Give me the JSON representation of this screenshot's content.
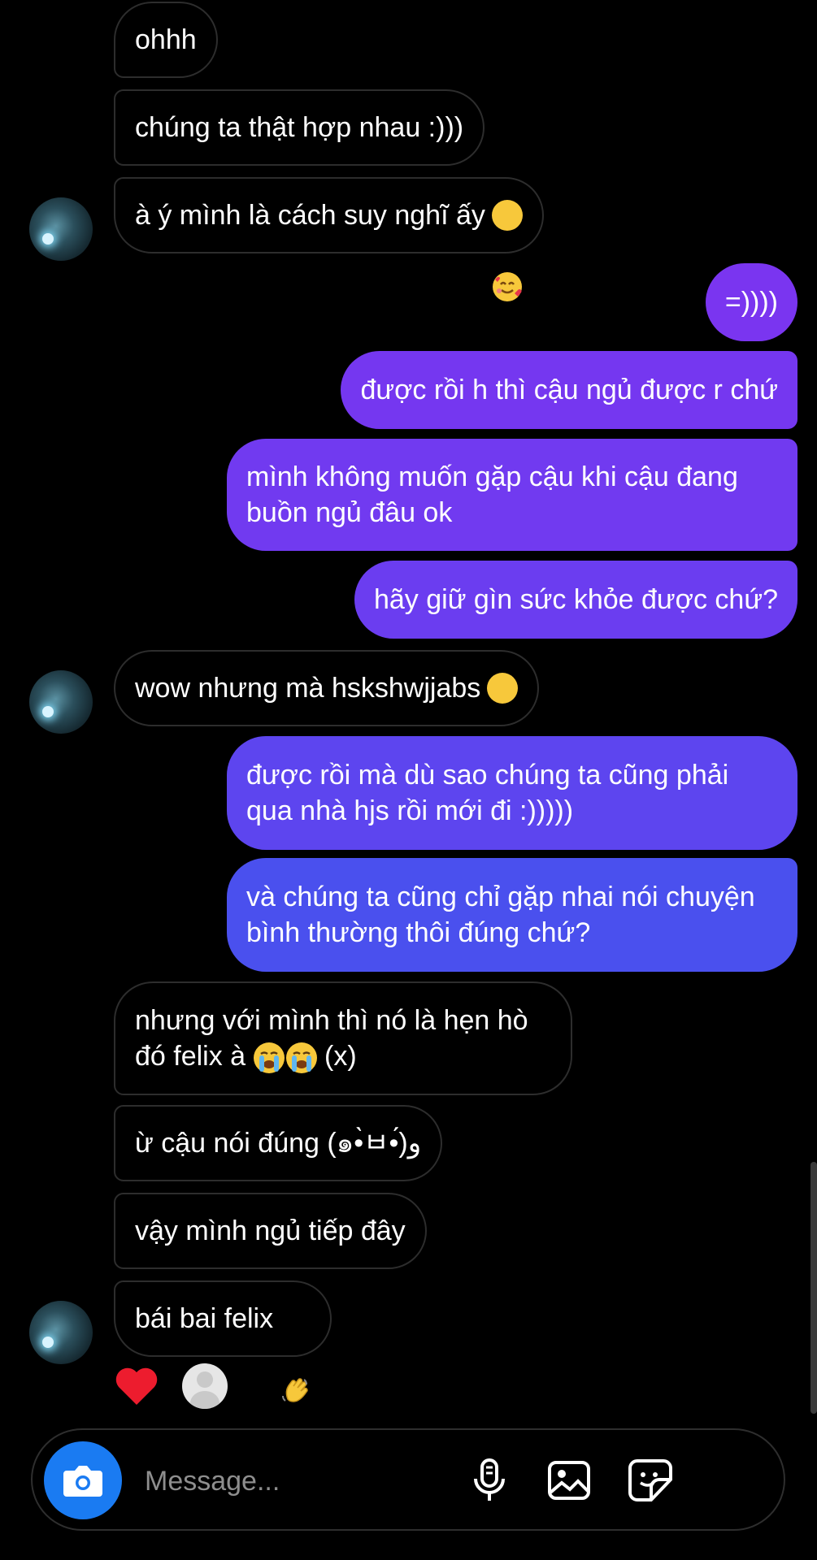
{
  "messages": [
    {
      "side": "in",
      "text": "ohhh"
    },
    {
      "side": "in",
      "text": "chúng ta thật hợp nhau :)))"
    },
    {
      "side": "in",
      "text": "à ý mình là cách suy nghĩ ấy",
      "emoji": "smiling-face-with-hearts"
    },
    {
      "side": "out",
      "text": "=))))"
    },
    {
      "side": "out",
      "text": "được rồi h thì cậu ngủ được r chứ"
    },
    {
      "side": "out",
      "text": "mình không muốn gặp cậu khi cậu đang buồn ngủ đâu ok"
    },
    {
      "side": "out",
      "text": "hãy giữ gìn sức khỏe được chứ?"
    },
    {
      "side": "in",
      "text": "wow nhưng mà hskshwjjabs",
      "emoji": "confounded-face"
    },
    {
      "side": "out",
      "text": "được rồi mà dù sao chúng ta cũng phải qua nhà hjs rồi mới đi :)))))"
    },
    {
      "side": "out",
      "text": "và chúng ta cũng chỉ gặp nhai nói chuyện bình thường thôi đúng chứ?"
    },
    {
      "side": "in",
      "text": "nhưng với mình thì nó là hẹn hò đó felix à",
      "emoji": "loudly-crying-face x2",
      "suffix": "(x)"
    },
    {
      "side": "in",
      "text": "ừ cậu nói đúng (๑•̀ㅂ•́)و"
    },
    {
      "side": "in",
      "text": "vậy mình ngủ tiếp đây"
    },
    {
      "side": "in",
      "text": "bái bai felix",
      "emoji": "waving-hand"
    }
  ],
  "reactions": {
    "heart": "red-heart-icon",
    "seen": "default-avatar-icon"
  },
  "composer": {
    "placeholder": "Message..."
  },
  "colors": {
    "background": "#000000",
    "outgoing_top": "#7a35f0",
    "outgoing_bottom": "#3d55ee",
    "incoming_border": "#2d2d2d",
    "camera": "#1a7bf2",
    "heart": "#ed1c2e"
  }
}
